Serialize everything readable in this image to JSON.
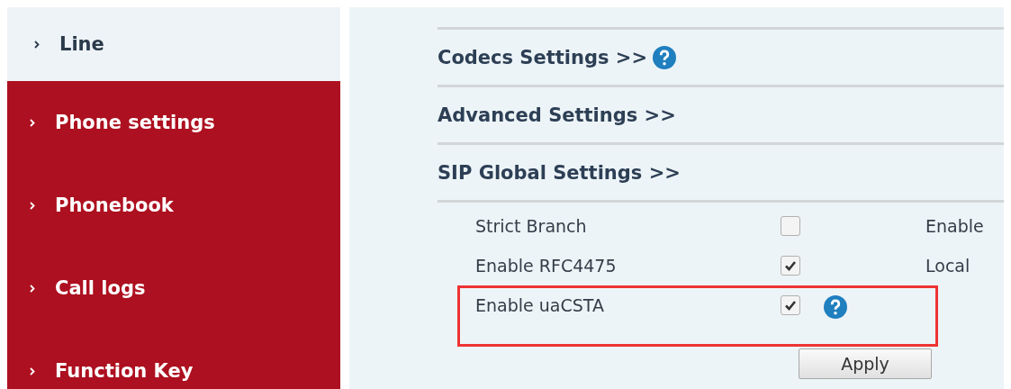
{
  "sidebar": {
    "items": [
      {
        "label": "Line",
        "selected": true
      },
      {
        "label": "Phone settings",
        "selected": false
      },
      {
        "label": "Phonebook",
        "selected": false
      },
      {
        "label": "Call logs",
        "selected": false
      },
      {
        "label": "Function Key",
        "selected": false
      }
    ]
  },
  "sections": [
    {
      "title": "Codecs Settings >>",
      "help": true
    },
    {
      "title": "Advanced Settings >>",
      "help": false
    },
    {
      "title": "SIP Global Settings >>",
      "help": false
    }
  ],
  "settings": [
    {
      "label": "Strict Branch",
      "checked": false,
      "help": false,
      "highlighted": false,
      "right_label": "Enable"
    },
    {
      "label": "Enable RFC4475",
      "checked": true,
      "help": false,
      "highlighted": false,
      "right_label": "Local"
    },
    {
      "label": "Enable uaCSTA",
      "checked": true,
      "help": true,
      "highlighted": true
    }
  ],
  "apply_button": "Apply"
}
